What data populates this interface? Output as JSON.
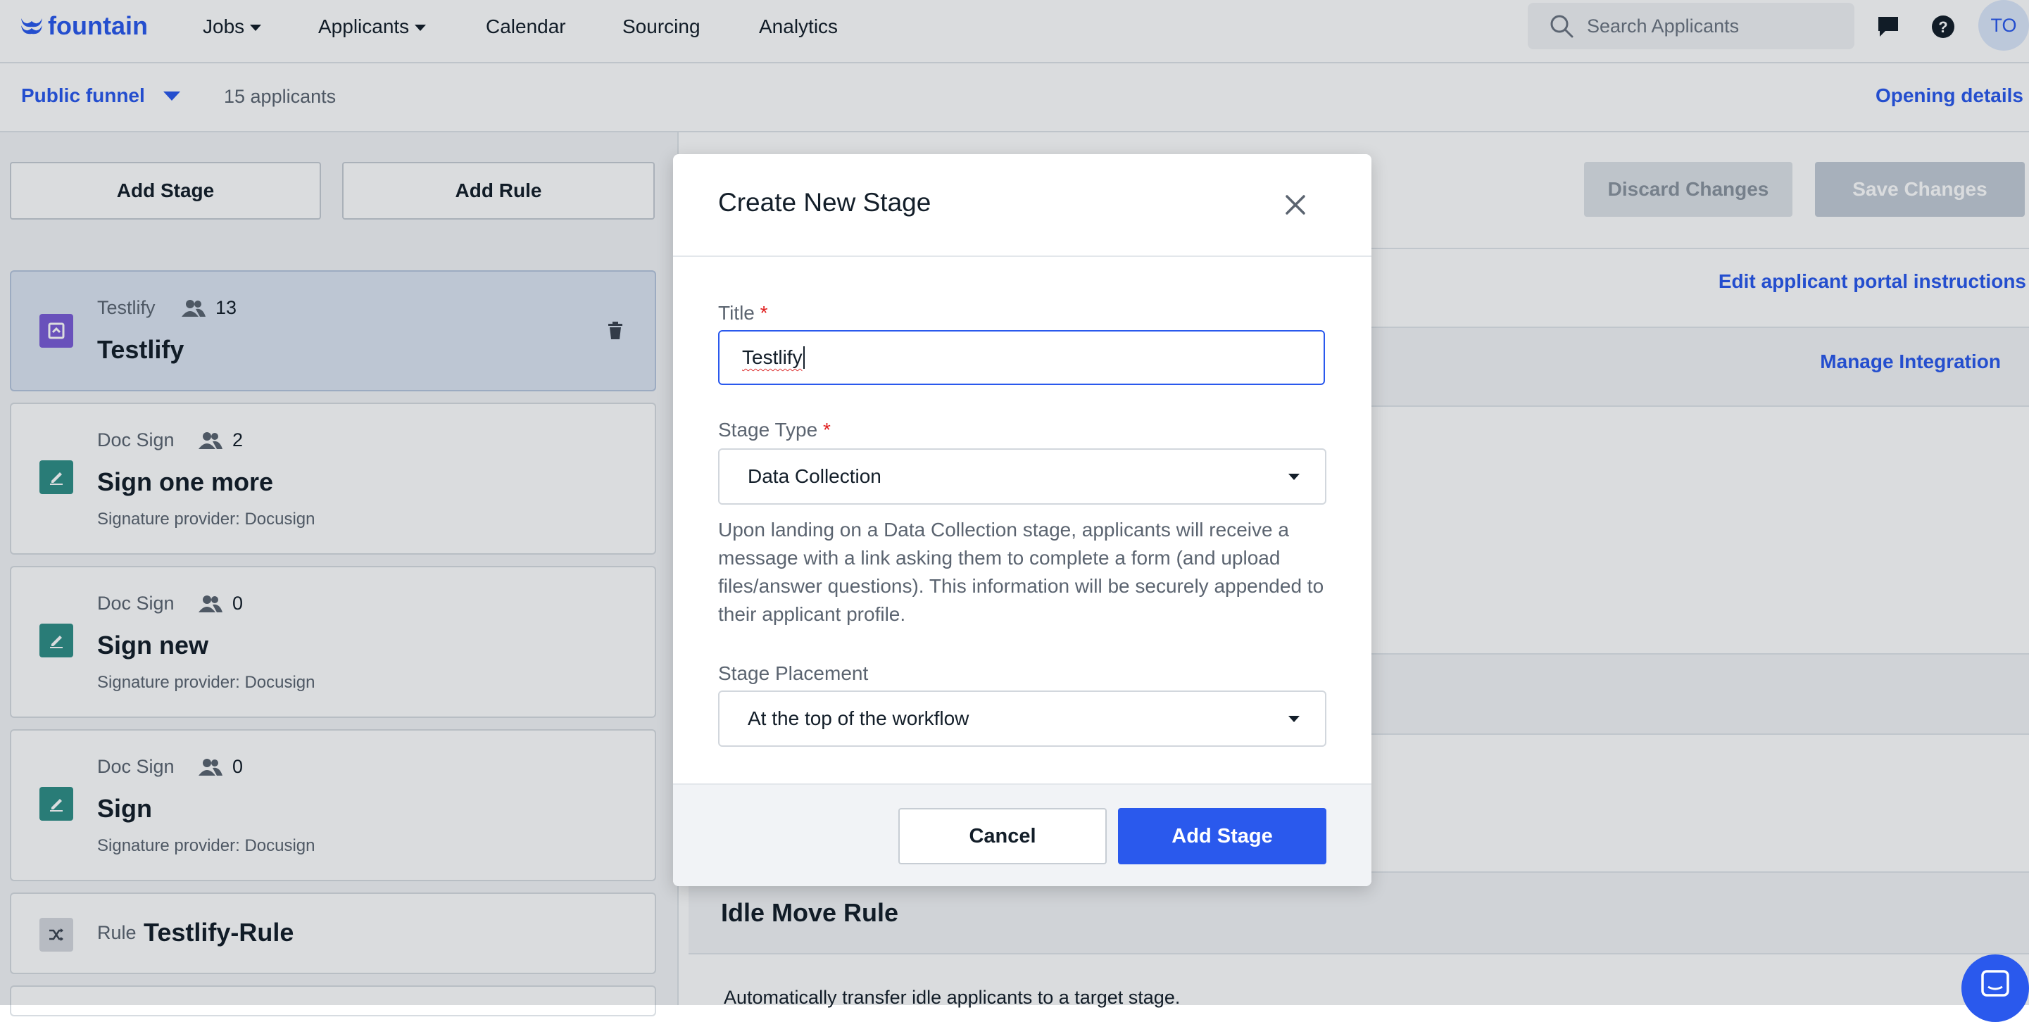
{
  "brand": {
    "name": "fountain",
    "accent": "#2a59ed"
  },
  "nav": {
    "items": [
      {
        "label": "Jobs",
        "dropdown": true
      },
      {
        "label": "Applicants",
        "dropdown": true
      },
      {
        "label": "Calendar",
        "dropdown": false
      },
      {
        "label": "Sourcing",
        "dropdown": false
      },
      {
        "label": "Analytics",
        "dropdown": false
      }
    ],
    "search_placeholder": "Search Applicants",
    "avatar_initials": "TO"
  },
  "subheader": {
    "funnel_label": "Public funnel",
    "applicant_count": "15 applicants",
    "opening_details": "Opening details"
  },
  "left": {
    "add_stage": "Add Stage",
    "add_rule": "Add Rule",
    "stages": [
      {
        "type": "Testlify",
        "count": "13",
        "title": "Testlify",
        "sub": "",
        "icon": "testlify-icon",
        "color": "#7b5cd6"
      },
      {
        "type": "Doc Sign",
        "count": "2",
        "title": "Sign one more",
        "sub": "Signature provider: Docusign",
        "icon": "signature-icon",
        "color": "#2f8f86"
      },
      {
        "type": "Doc Sign",
        "count": "0",
        "title": "Sign new",
        "sub": "Signature provider: Docusign",
        "icon": "signature-icon",
        "color": "#2f8f86"
      },
      {
        "type": "Doc Sign",
        "count": "0",
        "title": "Sign",
        "sub": "Signature provider: Docusign",
        "icon": "signature-icon",
        "color": "#2f8f86"
      }
    ],
    "rule": {
      "type": "Rule",
      "title": "Testlify-Rule",
      "icon": "shuffle-icon"
    }
  },
  "right": {
    "discard": "Discard Changes",
    "save": "Save Changes",
    "edit_portal": "Edit applicant portal instructions",
    "manage_integration": "Manage Integration",
    "idle_title": "Idle Move Rule",
    "idle_desc": "Automatically transfer idle applicants to a target stage."
  },
  "modal": {
    "title": "Create New Stage",
    "title_label": "Title",
    "title_value": "Testlify",
    "stage_type_label": "Stage Type",
    "stage_type_value": "Data Collection",
    "description": "Upon landing on a Data Collection stage, applicants will receive a message with a link asking them to complete a form (and upload files/answer questions). This information will be securely appended to their applicant profile.",
    "placement_label": "Stage Placement",
    "placement_value": "At the top of the workflow",
    "cancel": "Cancel",
    "add": "Add Stage"
  }
}
